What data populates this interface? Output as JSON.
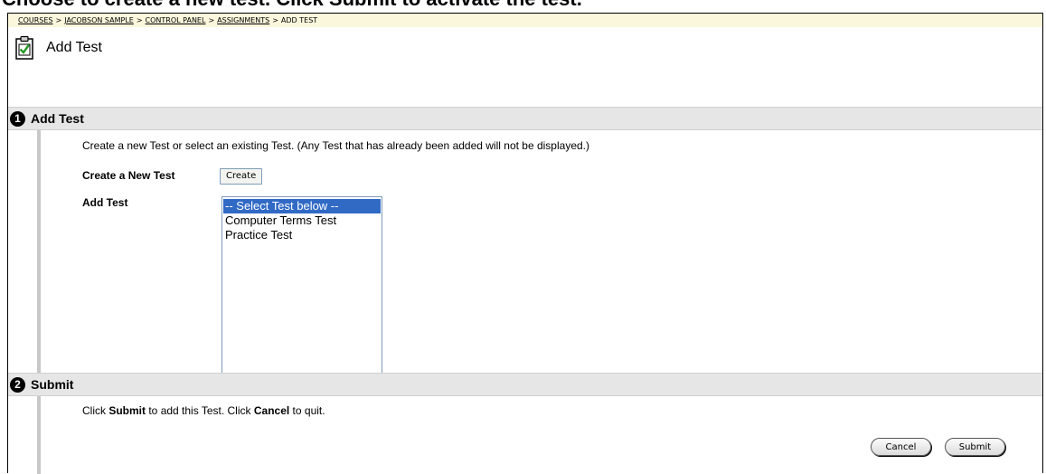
{
  "caption": "Choose to create a new test. Click Submit to activate the test.",
  "breadcrumb": {
    "items": [
      "COURSES",
      "JACOBSON SAMPLE",
      "CONTROL PANEL",
      "ASSIGNMENTS"
    ],
    "current": "ADD TEST",
    "separator": ">"
  },
  "page": {
    "title": "Add Test",
    "icon": "clipboard-check-icon"
  },
  "section1": {
    "number": "1",
    "title": "Add Test",
    "instructions": "Create a new Test or select an existing Test. (Any Test that has already been added will not be displayed.)",
    "create_label": "Create a New Test",
    "create_button": "Create",
    "add_label": "Add Test",
    "options": [
      "-- Select Test below --",
      "Computer Terms Test",
      "Practice Test"
    ],
    "selected_index": 0
  },
  "section2": {
    "number": "2",
    "title": "Submit",
    "instr_click": "Click ",
    "instr_submit": "Submit",
    "instr_mid": " to add this Test. Click ",
    "instr_cancel": "Cancel",
    "instr_end": " to quit.",
    "cancel_button": "Cancel",
    "submit_button": "Submit"
  },
  "colors": {
    "breadcrumb_bg": "#fbf7dc",
    "section_bar_bg": "#e6e6e6",
    "selection_bg": "#316ac5"
  }
}
